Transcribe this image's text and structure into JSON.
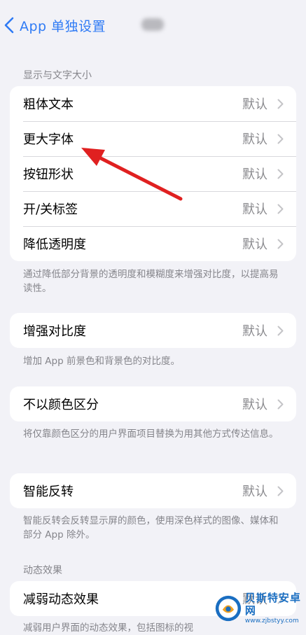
{
  "nav": {
    "back_label": "App 单独设置"
  },
  "display_section": {
    "header": "显示与文字大小",
    "rows": [
      {
        "label": "粗体文本",
        "value": "默认"
      },
      {
        "label": "更大字体",
        "value": "默认"
      },
      {
        "label": "按钮形状",
        "value": "默认"
      },
      {
        "label": "开/关标签",
        "value": "默认"
      },
      {
        "label": "降低透明度",
        "value": "默认"
      }
    ],
    "footnote": "通过降低部分背景的透明度和模糊度来增强对比度，以提高易读性。"
  },
  "contrast": {
    "label": "增强对比度",
    "value": "默认",
    "footnote": "增加 App 前景色和背景色的对比度。"
  },
  "differentiate": {
    "label": "不以颜色区分",
    "value": "默认",
    "footnote": "将仅靠颜色区分的用户界面项目替换为用其他方式传达信息。"
  },
  "smart_invert": {
    "label": "智能反转",
    "value": "默认",
    "footnote": "智能反转会反转显示屏的颜色，使用深色样式的图像、媒体和部分 App 除外。"
  },
  "motion_section": {
    "header": "动态效果",
    "reduce_motion": {
      "label": "减弱动态效果",
      "value": "默认"
    },
    "footnote": "减弱用户界面的动态效果，包括图标的视"
  },
  "watermark": {
    "brand": "贝斯特安卓网",
    "url": "www.zjbstyy.com"
  },
  "colors": {
    "accent": "#2f7bf5",
    "background": "#f2f2f7",
    "annotation_arrow": "#e02020"
  }
}
